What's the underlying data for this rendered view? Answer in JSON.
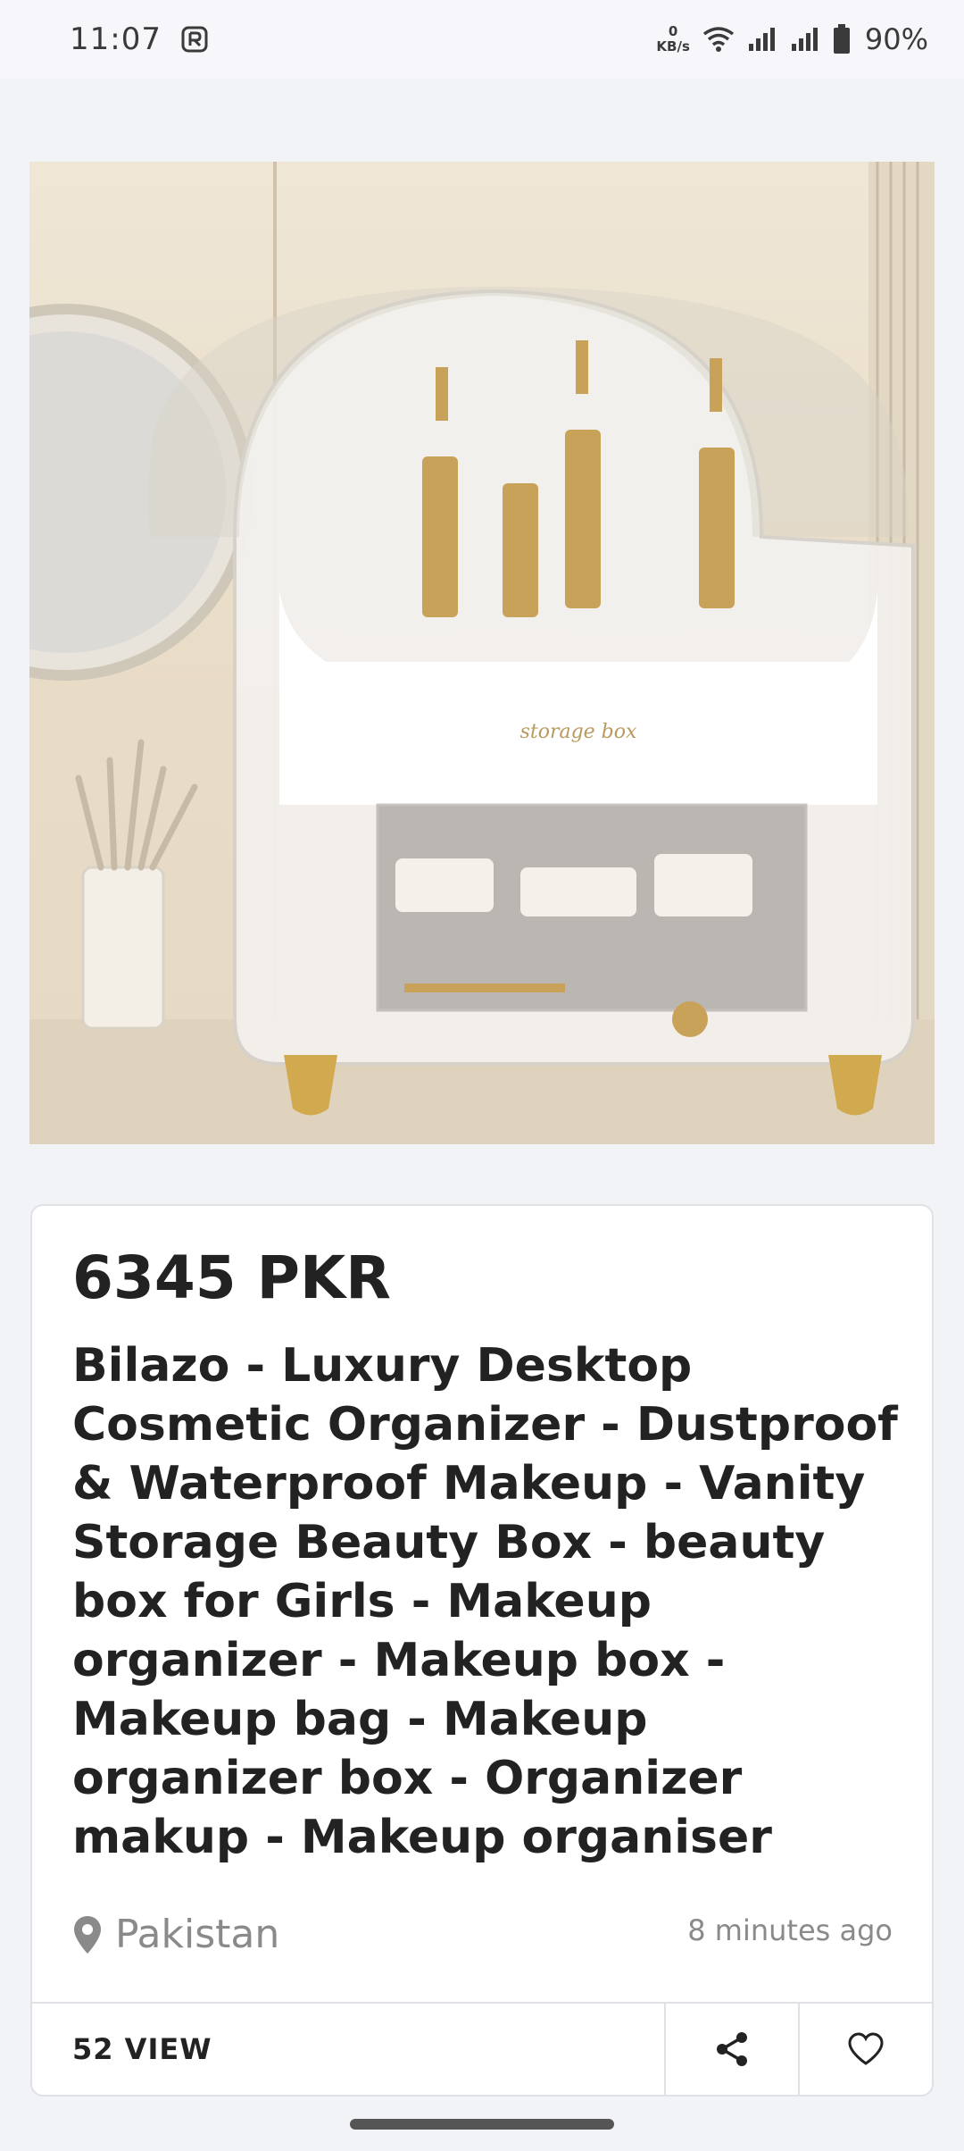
{
  "status_bar": {
    "time": "11:07",
    "network_speed_value": "0",
    "network_speed_unit": "KB/s",
    "battery": "90%"
  },
  "listing": {
    "price": "6345 PKR",
    "title": "Bilazo - Luxury Desktop Cosmetic Organizer - Dustproof & Waterproof Makeup - Vanity Storage Beauty Box - beauty box for Girls - Makeup organizer - Makeup box - Makeup bag - Makeup organizer box - Organizer makup - Makeup organiser",
    "location": "Pakistan",
    "posted": "8 minutes ago",
    "views": "52 VIEW",
    "image_label": "storage box"
  },
  "icons": {
    "location": "location-pin-icon",
    "share": "share-icon",
    "favorite": "heart-icon"
  }
}
